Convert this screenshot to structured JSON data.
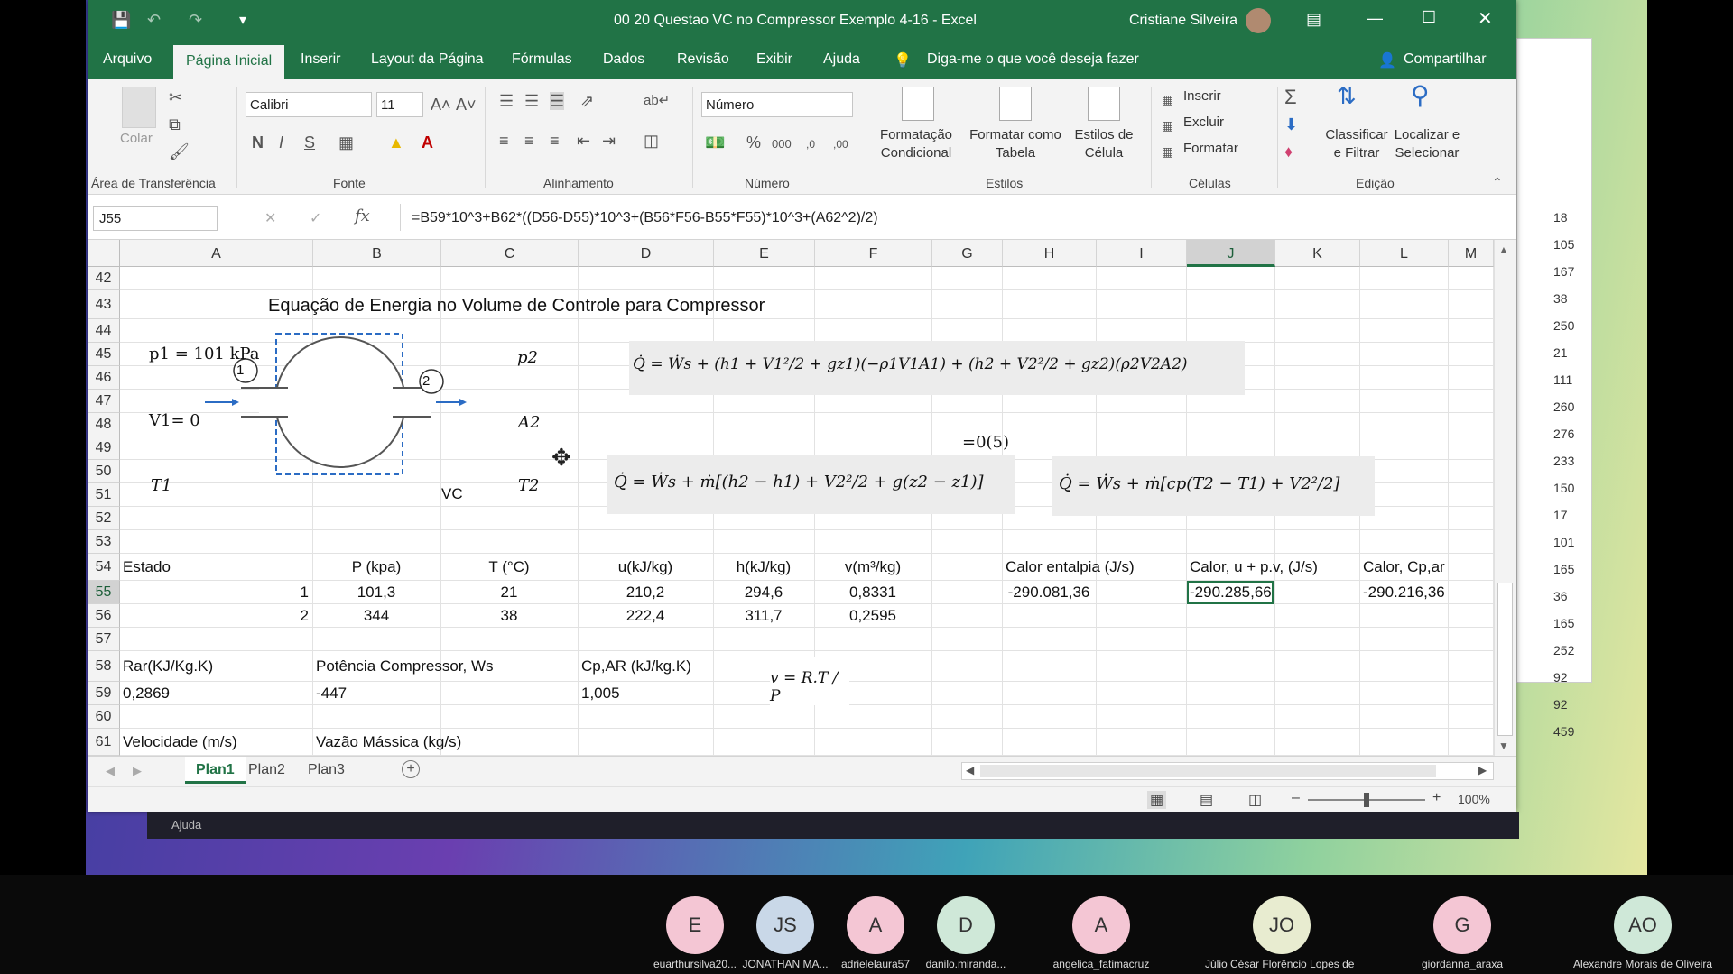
{
  "window": {
    "title": "00 20  Questao VC no Compressor Exemplo 4-16  -  Excel",
    "user": "Cristiane Silveira"
  },
  "menu": {
    "items": [
      "Arquivo",
      "Página Inicial",
      "Inserir",
      "Layout da Página",
      "Fórmulas",
      "Dados",
      "Revisão",
      "Exibir",
      "Ajuda"
    ],
    "tell_me": "Diga-me o que você deseja fazer",
    "share": "Compartilhar"
  },
  "ribbon": {
    "paste_label": "Colar",
    "clipboard_group": "Área de Transferência",
    "font_name": "Calibri",
    "font_size": "11",
    "bold": "N",
    "italic": "I",
    "strike": "S",
    "font_group": "Fonte",
    "align_group": "Alinhamento",
    "number_format": "Número",
    "number_group": "Número",
    "cond_format": "Formatação Condicional",
    "format_table": "Formatar como Tabela",
    "cell_styles": "Estilos de Célula",
    "styles_group": "Estilos",
    "insert": "Inserir",
    "delete": "Excluir",
    "format": "Formatar",
    "cells_group": "Células",
    "sort_filter": "Classificar e Filtrar",
    "find_select": "Localizar e Selecionar",
    "edit_group": "Edição"
  },
  "formula_bar": {
    "name_box": "J55",
    "formula": "=B59*10^3+B62*((D56-D55)*10^3+(B56*F56-B55*F55)*10^3+(A62^2)/2)"
  },
  "columns": [
    "A",
    "B",
    "C",
    "D",
    "E",
    "F",
    "G",
    "H",
    "I",
    "J",
    "K",
    "L",
    "M"
  ],
  "rows": [
    "42",
    "43",
    "44",
    "45",
    "46",
    "47",
    "48",
    "49",
    "50",
    "51",
    "52",
    "53",
    "54",
    "55",
    "56",
    "57",
    "58",
    "59",
    "60",
    "61"
  ],
  "sheet": {
    "title": "Equação de Energia no Volume de Controle para Compressor",
    "headers": [
      "Estado",
      "P (kpa)",
      "T (°C)",
      "u(kJ/kg)",
      "h(kJ/kg)",
      "v(m³/kg)",
      "Calor entalpia (J/s)",
      "Calor, u + p.v,  (J/s)",
      "Calor, Cp,ar"
    ],
    "data": [
      [
        "1",
        "101,3",
        "21",
        "210,2",
        "294,6",
        "0,8331",
        "-290.081,36",
        "-290.285,66",
        "-290.216,36"
      ],
      [
        "2",
        "344",
        "38",
        "222,4",
        "311,7",
        "0,2595"
      ]
    ],
    "r58": {
      "rar": "Rar(KJ/Kg.K)",
      "w": "Potência  Compressor, Ws",
      "cp": "Cp,AR (kJ/kg.K)"
    },
    "r59": {
      "rar": "0,2869",
      "w": "-447",
      "cp": "1,005"
    },
    "r61": {
      "vel": "Velocidade (m/s)",
      "vazao": "Vazão Mássica (kg/s)"
    }
  },
  "diagram": {
    "p1": "p1 = 101 kPa",
    "v1": "V1= 0",
    "t1": "T1",
    "p2": "p2",
    "a2": "A2",
    "t2": "T2",
    "vc": "VC",
    "n1": "1",
    "n2": "2"
  },
  "equations": {
    "e1": "Q̇ = Ẇs + (h1 + V1²/2 + gz1)(−ρ1V1A1) + (h2 + V2²/2 + gz2)(ρ2V2A2)",
    "e2": "Q̇ = Ẇs + ṁ[(h2 − h1) + V2²/2 + g(z2 − z1)]",
    "e2note": "=0(5)",
    "e3": "Q̇ = Ẇs + ṁ[cp(T2 − T1) + V2²/2]",
    "ideal_gas": "v = R.T / P"
  },
  "sheet_tabs": [
    "Plan1",
    "Plan2",
    "Plan3"
  ],
  "status": {
    "zoom": "100%"
  },
  "behind_help": "Ajuda",
  "behind_numbers": [
    "18",
    "105",
    "167",
    "38",
    "250",
    "21",
    "111",
    "260",
    "276",
    "233",
    "150",
    "17",
    "101",
    "165",
    "36",
    "165",
    "252",
    "92",
    "92",
    "459"
  ],
  "participants": [
    {
      "initials": "E",
      "name": "euarthursilva20...",
      "color": "#f4c6d4"
    },
    {
      "initials": "JS",
      "name": "JONATHAN MA...",
      "color": "#c9d8e8"
    },
    {
      "initials": "A",
      "name": "adrielelaura57",
      "color": "#f4c6d4"
    },
    {
      "initials": "D",
      "name": "danilo.miranda...",
      "color": "#cfe8d8"
    },
    {
      "initials": "A",
      "name": "angelica_fatimacruz",
      "color": "#f4c6d4"
    },
    {
      "initials": "JO",
      "name": "Júlio César Florêncio Lopes de Olive...",
      "color": "#e8ecd0"
    },
    {
      "initials": "G",
      "name": "giordanna_araxa",
      "color": "#f4c6d4"
    },
    {
      "initials": "AO",
      "name": "Alexandre Morais de Oliveira",
      "color": "#cfe8d8"
    }
  ]
}
